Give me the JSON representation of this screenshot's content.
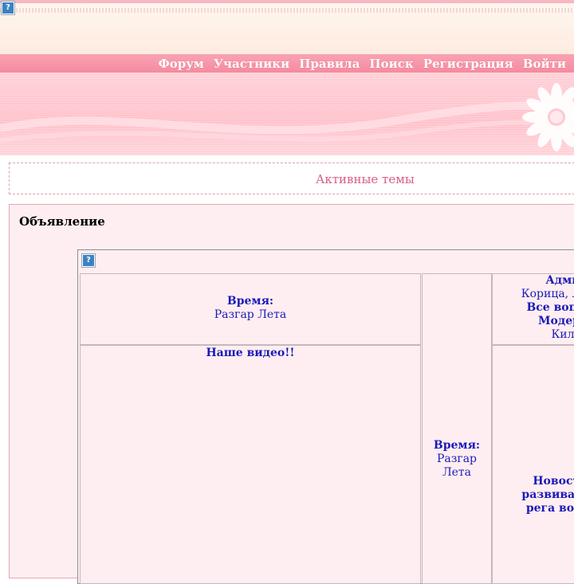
{
  "nav": {
    "items": [
      "Форум",
      "Участники",
      "Правила",
      "Поиск",
      "Регистрация",
      "Войти"
    ]
  },
  "active_topics": "Активные темы",
  "announcement": {
    "title": "Объявление",
    "time_label": "Время:",
    "time_value": "Разгар Лета",
    "video_title": "Наше видео!!",
    "mid_time_label": "Время:",
    "mid_time_line1": "Разгар",
    "mid_time_line2": "Лета",
    "admin_heading": "Адми",
    "admin_names": "Корица, Люба",
    "admin_questions": "Все вопрос",
    "moderators_heading": "Модера",
    "moderators_names": "Кил",
    "news_heading": "Новости!",
    "news_line2": "развивается",
    "news_line3": "рега во все"
  },
  "icons": {
    "broken_image": "question-mark-icon"
  },
  "colors": {
    "nav_bg": "#f58a9f",
    "link_pink": "#d95f86",
    "text_blue": "#1a1ab8",
    "panel_bg": "#ffeef1"
  }
}
